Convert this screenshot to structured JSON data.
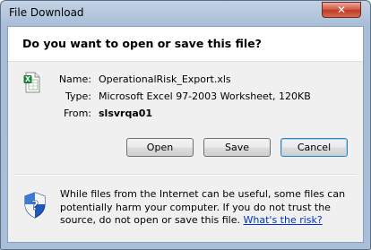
{
  "window": {
    "title": "File Download",
    "close_label": "✕"
  },
  "dialog": {
    "question": "Do you want to open or save this file?",
    "file": {
      "icon": "excel-file-icon",
      "name_label": "Name:",
      "name_value": "OperationalRisk_Export.xls",
      "type_label": "Type:",
      "type_value": "Microsoft Excel 97-2003 Worksheet, 120KB",
      "from_label": "From:",
      "from_value": "slsvrqa01"
    },
    "buttons": {
      "open": "Open",
      "save": "Save",
      "cancel": "Cancel"
    },
    "warning": {
      "icon": "security-shield-icon",
      "text": "While files from the Internet can be useful, some files can potentially harm your computer. If you do not trust the source, do not open or save this file.",
      "link": "What's the risk?"
    }
  },
  "colors": {
    "title_bar": "#b9cbe1",
    "close_button": "#c8452e",
    "link": "#0033cc",
    "default_button_border": "#3c7fb1"
  }
}
